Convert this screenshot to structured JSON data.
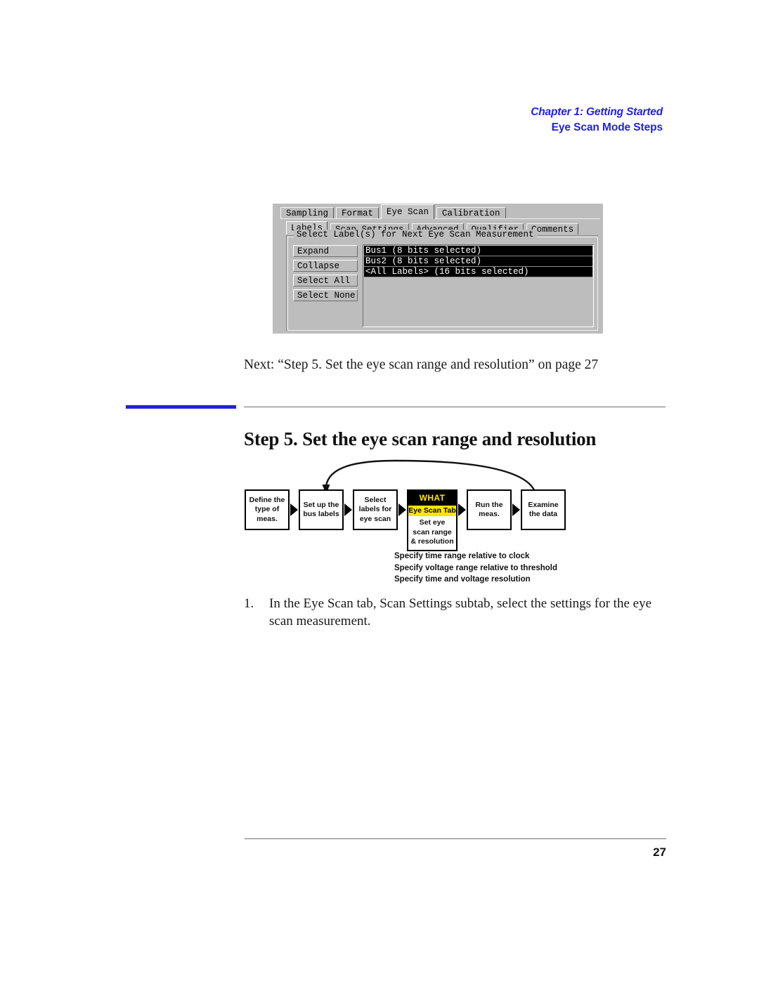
{
  "header": {
    "chapter_label": "Chapter 1: Getting Started",
    "section_label": "Eye Scan Mode Steps",
    "accent_color": "#2222dd"
  },
  "ui_screenshot": {
    "tabs": [
      {
        "label": "Sampling",
        "active": false
      },
      {
        "label": "Format",
        "active": false
      },
      {
        "label": "Eye Scan",
        "active": true
      },
      {
        "label": "Calibration",
        "active": false
      }
    ],
    "subtabs": [
      {
        "label": "Labels",
        "active": true
      },
      {
        "label": "Scan Settings",
        "active": false
      },
      {
        "label": "Advanced",
        "active": false
      },
      {
        "label": "Qualifier",
        "active": false
      },
      {
        "label": "Comments",
        "active": false
      }
    ],
    "groupbox_title": "Select Label(s) for Next Eye Scan Measurement",
    "buttons": [
      {
        "label": "Expand"
      },
      {
        "label": "Collapse"
      },
      {
        "label": "Select All"
      },
      {
        "label": "Select None"
      }
    ],
    "label_list": [
      {
        "text": "Bus1 (8 bits selected)",
        "selected": true
      },
      {
        "text": "Bus2 (8 bits selected)",
        "selected": true
      },
      {
        "text": "<All Labels> (16 bits selected)",
        "selected": true
      }
    ]
  },
  "next_xref": "Next: “Step 5. Set the eye scan range and resolution” on page 27",
  "section": {
    "heading": "Step 5. Set the eye scan range and resolution"
  },
  "flow_diagram": {
    "boxes": [
      {
        "lines": [
          "Define the",
          "type of",
          "meas."
        ],
        "highlight": false
      },
      {
        "lines": [
          "Set up the",
          "bus labels"
        ],
        "highlight": false
      },
      {
        "lines": [
          "Select",
          "labels for",
          "eye scan"
        ],
        "highlight": false
      },
      {
        "lines": [
          "Set eye",
          "scan range",
          "& resolution"
        ],
        "highlight": true,
        "what_label": "WHAT",
        "tab_label": "Eye Scan Tab"
      },
      {
        "lines": [
          "Run the",
          "meas."
        ],
        "highlight": false
      },
      {
        "lines": [
          "Examine",
          "the data"
        ],
        "highlight": false
      }
    ],
    "notes": [
      "Specify time range relative to clock",
      "Specify voltage range relative to threshold",
      "Specify time and voltage resolution"
    ],
    "highlight_colors": {
      "background": "#ffe600",
      "text": "#000000",
      "banner_bg": "#000000",
      "banner_text": "#ffe600"
    }
  },
  "steps": [
    {
      "number": "1.",
      "text": "In the Eye Scan tab, Scan Settings subtab, select the settings for the eye scan measurement."
    }
  ],
  "footer": {
    "page_number": "27"
  }
}
